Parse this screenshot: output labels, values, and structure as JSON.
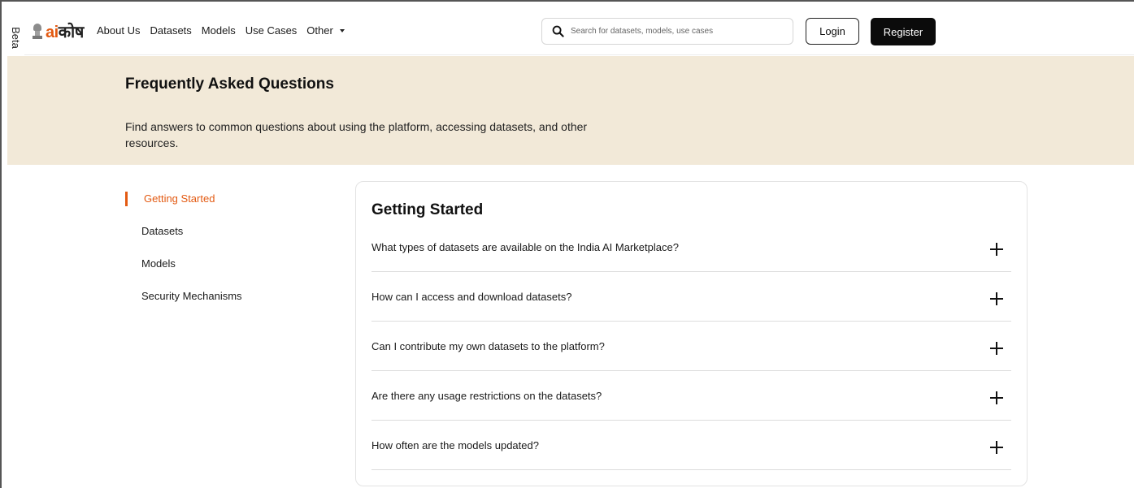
{
  "beta_label": "Beta",
  "brand": {
    "logo_ai": "ai",
    "logo_kosh": "कोष"
  },
  "nav": {
    "about": "About Us",
    "datasets": "Datasets",
    "models": "Models",
    "use_cases": "Use Cases",
    "other": "Other"
  },
  "search": {
    "placeholder": "Search for datasets, models, use cases",
    "value": ""
  },
  "auth": {
    "login": "Login",
    "register": "Register"
  },
  "hero": {
    "title": "Frequently Asked Questions",
    "subtitle": "Find answers to common questions about using the platform, accessing datasets, and other resources."
  },
  "sidebar": {
    "items": [
      {
        "label": "Getting Started",
        "active": true
      },
      {
        "label": "Datasets",
        "active": false
      },
      {
        "label": "Models",
        "active": false
      },
      {
        "label": "Security Mechanisms",
        "active": false
      }
    ]
  },
  "faq": {
    "section_title": "Getting Started",
    "questions": [
      {
        "q": "What types of datasets are available on the India AI Marketplace?"
      },
      {
        "q": "How can I access and download datasets?"
      },
      {
        "q": "Can I contribute my own datasets to the platform?"
      },
      {
        "q": "Are there any usage restrictions on the datasets?"
      },
      {
        "q": "How often are the models updated?"
      }
    ]
  },
  "colors": {
    "accent": "#e35a12",
    "hero_bg": "#f2e9d8",
    "dark": "#0b0b0b"
  },
  "icons": {
    "search": "search-icon",
    "caret": "chevron-down-icon",
    "expand": "plus-icon",
    "emblem": "national-emblem-icon"
  }
}
